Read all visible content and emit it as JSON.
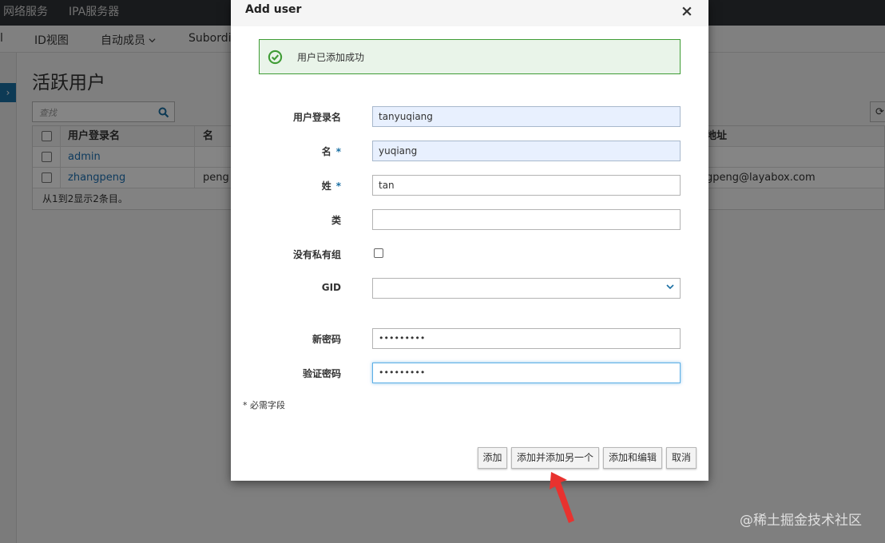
{
  "app": {
    "top_nav": [
      "网络服务",
      "IPA服务器"
    ],
    "sub_nav": [
      "l",
      "ID视图",
      "自动成员",
      "Subordi"
    ],
    "rail_button": "›"
  },
  "page": {
    "title": "活跃用户",
    "search_placeholder": "查找",
    "table": {
      "headers": {
        "login": "用户登录名",
        "first": "名",
        "email": "地址"
      },
      "rows": [
        {
          "login": "admin",
          "first": "",
          "email": ""
        },
        {
          "login": "zhangpeng",
          "first": "peng",
          "email": "gpeng@layabox.com"
        }
      ],
      "footer": "从1到2显示2条目。"
    }
  },
  "modal": {
    "title": "Add user",
    "close": "×",
    "alert": "用户已添加成功",
    "fields": {
      "login_label": "用户登录名",
      "login_value": "tanyuqiang",
      "first_label": "名",
      "first_value": "yuqiang",
      "last_label": "姓",
      "last_value": "tan",
      "class_label": "类",
      "class_value": "",
      "noprivate_label": "没有私有组",
      "gid_label": "GID",
      "gid_value": "",
      "newpw_label": "新密码",
      "newpw_value": "•••••••••",
      "verifypw_label": "验证密码",
      "verifypw_value": "•••••••••"
    },
    "required_marker": "*",
    "required_note": "* 必需字段",
    "buttons": {
      "add": "添加",
      "add_another": "添加并添加另一个",
      "add_edit": "添加和编辑",
      "cancel": "取消"
    }
  },
  "watermark": "@稀土掘金技术社区",
  "colors": {
    "accent": "#1a6fa3",
    "success_border": "#3f9c35",
    "annotation_arrow": "#e8322f"
  }
}
